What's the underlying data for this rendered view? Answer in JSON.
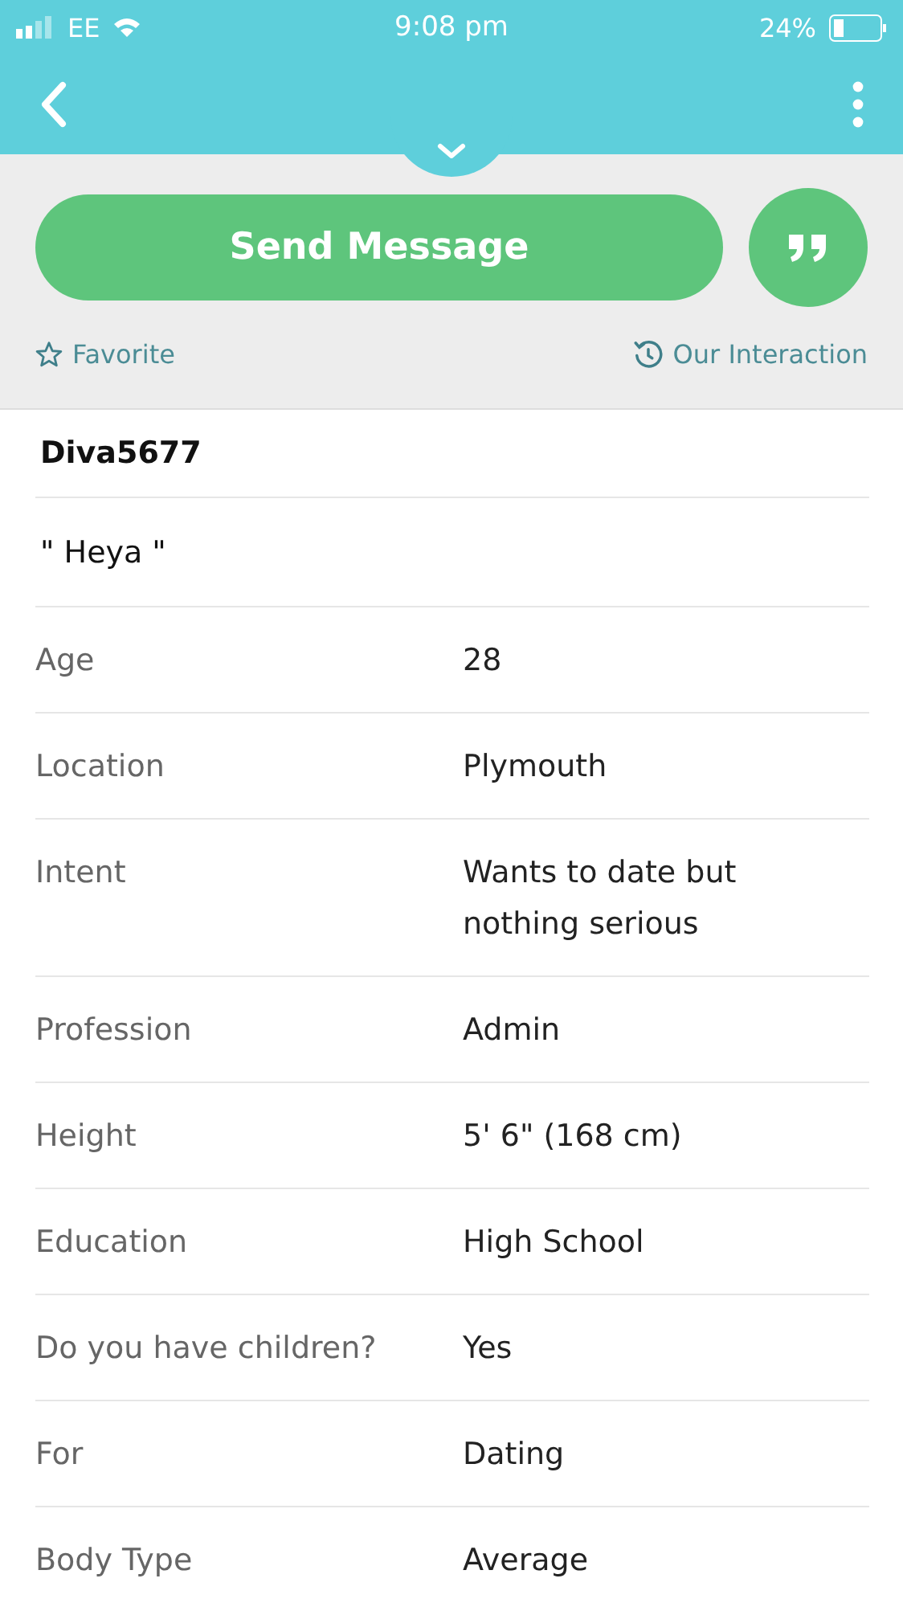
{
  "status_bar": {
    "carrier": "EE",
    "time": "9:08 pm",
    "battery": "24%"
  },
  "actions": {
    "send_button": "Send Message",
    "favorite": "Favorite",
    "interaction": "Our Interaction"
  },
  "profile": {
    "username": "Diva5677",
    "tagline": "\" Heya \"",
    "fields": [
      {
        "label": "Age",
        "value": "28"
      },
      {
        "label": "Location",
        "value": "Plymouth"
      },
      {
        "label": "Intent",
        "value": "Wants to date but nothing serious"
      },
      {
        "label": "Profession",
        "value": "Admin"
      },
      {
        "label": "Height",
        "value": "5' 6\" (168 cm)"
      },
      {
        "label": "Education",
        "value": "High School"
      },
      {
        "label": "Do you have children?",
        "value": "Yes"
      },
      {
        "label": "For",
        "value": "Dating"
      },
      {
        "label": "Body Type",
        "value": "Average"
      }
    ]
  }
}
